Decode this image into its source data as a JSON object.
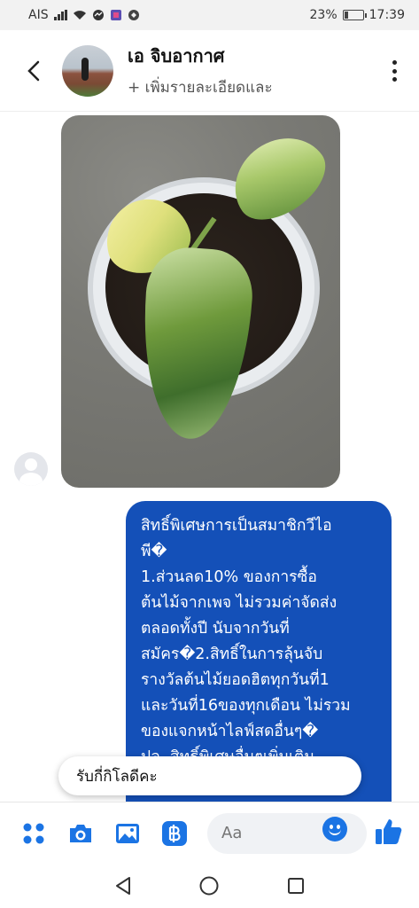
{
  "status_bar": {
    "carrier": "AIS",
    "battery": "23%",
    "battery_level": 0.23,
    "time": "17:39"
  },
  "header": {
    "contact_name": "เอ จิบอากาศ",
    "contact_subtitle": "+ เพิ่มรายละเอียดและ"
  },
  "chat": {
    "message_text": "สิทธิ์พิเศษการเป็นสมาชิกวีไอ\nพี�\n1.ส่วนลด10% ของการซื้อ\nต้นไม้จากเพจ ไม่รวมค่าจัดส่ง\nตลอดทั้งปี นับจากวันที่\nสมัคร�2.สิทธิ์ในการลุ้นจับ\nรางวัลต้นไม้ยอดฮิตทุกวันที่1\nและวันที่16ของทุกเดือน ไม่รวม\nของแจกหน้าไลฟ์สดอื่นๆ�\nปล. สิทธิ์พิเศษอื่นๆเพิ่มเติม",
    "quick_reply": "รับกี่กิโลดีคะ"
  },
  "composer": {
    "placeholder": "Aa"
  },
  "colors": {
    "accent": "#1b74e4",
    "bubble": "#1450b8"
  },
  "icons": {
    "back": "chevron-left-icon",
    "more": "more-vertical-icon",
    "menu": "grid-dots-icon",
    "camera": "camera-icon",
    "gallery": "image-icon",
    "pay": "baht-icon",
    "emoji": "smiley-icon",
    "like": "thumbs-up-icon"
  }
}
